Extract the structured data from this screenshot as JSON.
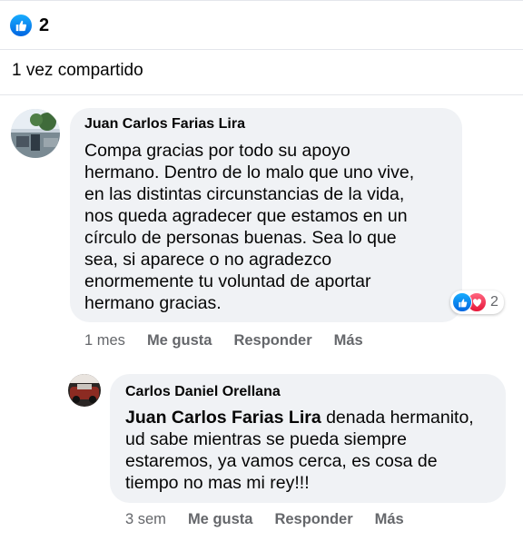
{
  "post": {
    "reaction_count": "2",
    "shares_text": "1 vez compartido"
  },
  "comments": [
    {
      "author": "Juan Carlos Farias Lira",
      "lines": [
        "Compa gracias por todo su apoyo",
        "hermano. Dentro de lo malo que uno vive,",
        "en las distintas circunstancias de la vida,",
        "nos queda agradecer que estamos en un",
        "círculo de personas buenas. Sea lo que",
        "sea, si aparece o no agradezco",
        "enormemente tu voluntad de aportar",
        "hermano gracias."
      ],
      "reaction_count": "2",
      "time": "1 mes",
      "like_label": "Me gusta",
      "reply_label": "Responder",
      "more_label": "Más"
    },
    {
      "author": "Carlos Daniel Orellana",
      "mention": "Juan Carlos Farias Lira",
      "first_line_rest": " denada hermanito,",
      "lines": [
        "ud sabe mientras se pueda siempre",
        "estaremos, ya vamos cerca, es cosa de",
        "tiempo no mas mi rey!!!"
      ],
      "time": "3 sem",
      "like_label": "Me gusta",
      "reply_label": "Responder",
      "more_label": "Más"
    }
  ],
  "icons": {
    "like": "thumbs-up-icon",
    "love": "heart-icon"
  },
  "colors": {
    "like_blue": "#0866ff",
    "love_red": "#f33e58",
    "bubble_bg": "#f0f2f5",
    "secondary_text": "#65676b"
  }
}
